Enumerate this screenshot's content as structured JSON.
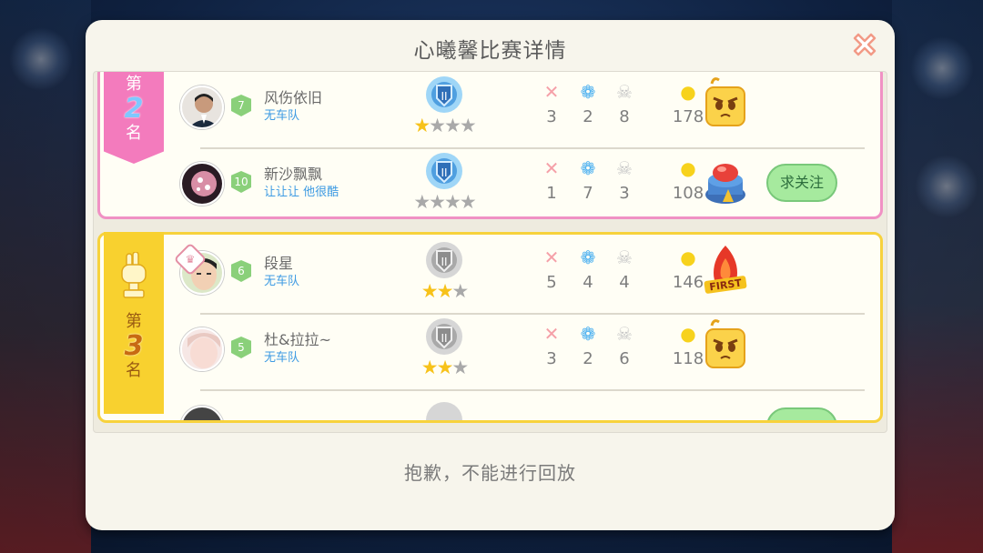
{
  "dialog": {
    "title": "心曦馨比赛详情",
    "close_icon": "close-x-icon",
    "message": "抱歉，不能进行回放"
  },
  "groups": [
    {
      "rank_prefix": "第",
      "rank_number": "2",
      "rank_suffix": "名",
      "color": "#f37bbd",
      "players": [
        {
          "name": "风伤依旧",
          "team": "无车队",
          "level": "7",
          "stars_filled": 1,
          "stars_total": 4,
          "kills": "3",
          "assists": "2",
          "deaths": "8",
          "points": "178",
          "badge_icon": "angry-block-icon",
          "medal_icon": "blue-shield-medal-icon"
        },
        {
          "name": "新沙飘飘",
          "team": "让让让  他很酷",
          "level": "10",
          "stars_filled": 0,
          "stars_total": 4,
          "kills": "1",
          "assists": "7",
          "deaths": "3",
          "points": "108",
          "badge_icon": "red-button-badge-icon",
          "medal_icon": "blue-shield-medal-icon",
          "follow_label": "求关注"
        }
      ]
    },
    {
      "rank_prefix": "第",
      "rank_number": "3",
      "rank_suffix": "名",
      "color": "#f8d12f",
      "players": [
        {
          "name": "段星",
          "team": "无车队",
          "level": "6",
          "stars_filled": 2,
          "stars_total": 3,
          "kills": "5",
          "assists": "4",
          "deaths": "4",
          "points": "146",
          "badge_icon": "first-flame-badge-icon",
          "medal_icon": "silver-shield-medal-icon"
        },
        {
          "name": "杜&拉拉~",
          "team": "无车队",
          "level": "5",
          "stars_filled": 2,
          "stars_total": 3,
          "kills": "3",
          "assists": "2",
          "deaths": "6",
          "points": "118",
          "badge_icon": "angry-block-icon",
          "medal_icon": "silver-shield-medal-icon"
        }
      ]
    }
  ],
  "colors": {
    "kills": "#f5a0a8",
    "assists": "#46aef0",
    "deaths": "#c7c7c7",
    "points": "#f7d21c"
  }
}
